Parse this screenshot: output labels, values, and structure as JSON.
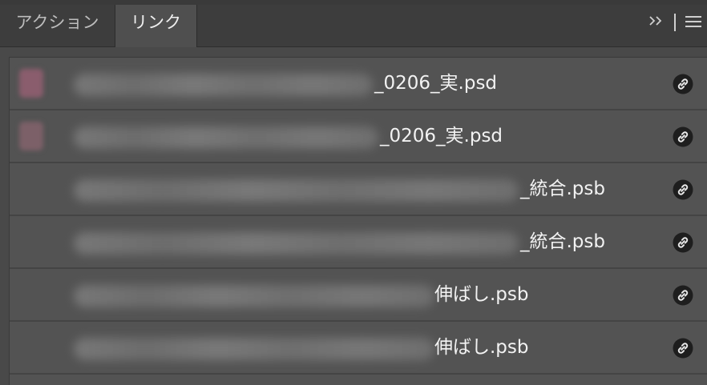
{
  "tabs": [
    {
      "label": "アクション",
      "active": false
    },
    {
      "label": "リンク",
      "active": true
    }
  ],
  "header_controls": {
    "collapse_icon": "double-chevron-right-icon",
    "menu_icon": "hamburger-menu-icon"
  },
  "links": [
    {
      "filename_visible": "_0206_実.psd",
      "status_icon": "link-icon",
      "thumb_color": "#8a5d6d"
    },
    {
      "filename_visible": "_0206_実.psd",
      "status_icon": "link-icon",
      "thumb_color": "#7c6068"
    },
    {
      "filename_visible": "_統合.psb",
      "status_icon": "link-icon",
      "thumb_color": ""
    },
    {
      "filename_visible": "_統合.psb",
      "status_icon": "link-icon",
      "thumb_color": ""
    },
    {
      "filename_visible": "伸ばし.psb",
      "status_icon": "link-icon",
      "thumb_color": ""
    },
    {
      "filename_visible": "伸ばし.psb",
      "status_icon": "link-icon",
      "thumb_color": ""
    }
  ],
  "colors": {
    "panel_bg": "#535353",
    "tab_active_bg": "#4f4f4f",
    "tabbar_bg": "#3d3d3d",
    "text": "#f2f2f2"
  }
}
